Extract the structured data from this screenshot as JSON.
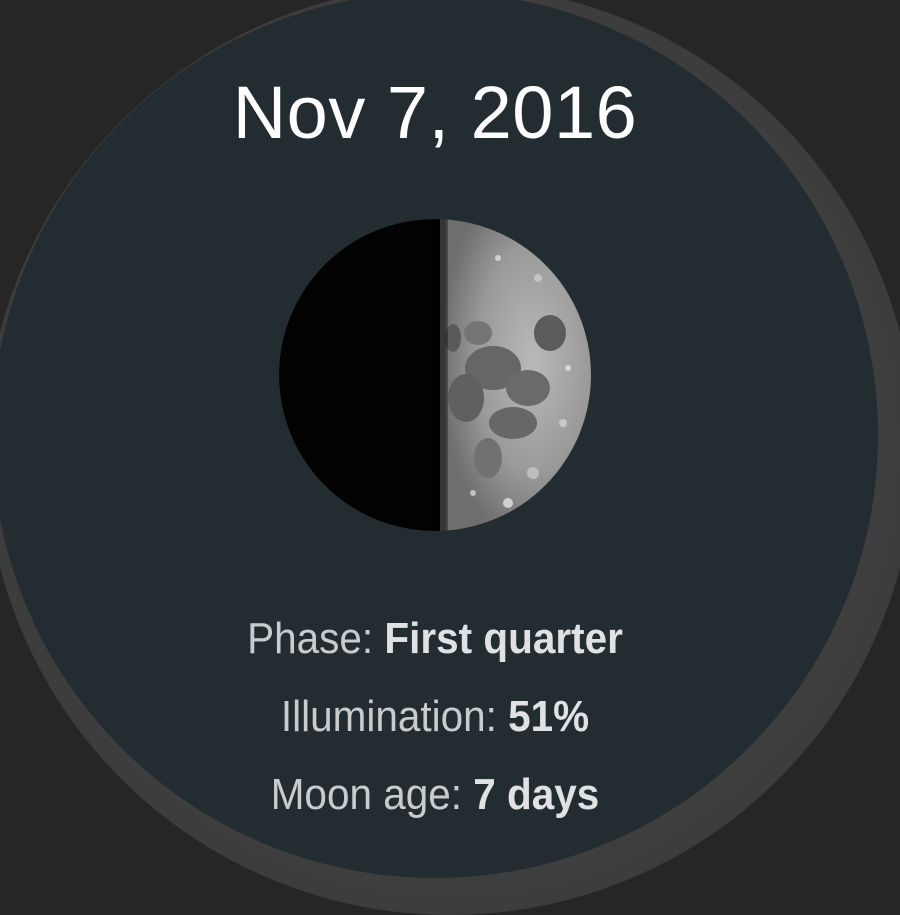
{
  "watchface": {
    "date": "Nov 7, 2016",
    "phase_label": "Phase: ",
    "phase_value": "First quarter",
    "illumination_label": "Illumination: ",
    "illumination_value": "51%",
    "age_label": "Moon age: ",
    "age_value": "7 days",
    "illumination_fraction": 0.51
  },
  "colors": {
    "background": "#262626",
    "bezel": "#404040",
    "face": "#232d31",
    "text_primary": "#ffffff",
    "text_secondary": "#c9cccd"
  },
  "icons": {
    "moon": "moon-first-quarter-image"
  }
}
